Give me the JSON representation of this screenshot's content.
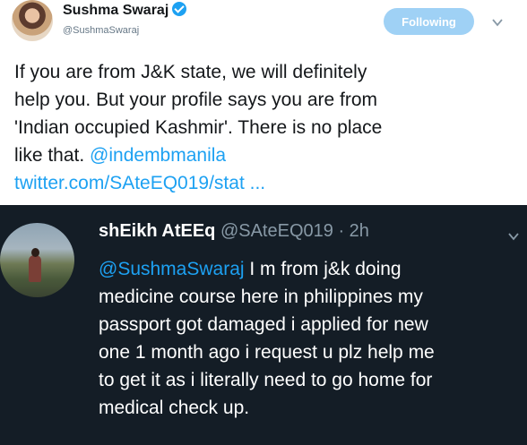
{
  "tweet": {
    "author": {
      "name": "Sushma Swaraj",
      "handle": "@SushmaSwaraj",
      "verified": true
    },
    "follow_button_label": "Following",
    "text_lines": [
      "If you are from J&K state, we will definitely",
      "help you. But your profile says you are from",
      "'Indian occupied Kashmir'. There is no place"
    ],
    "text_line4_plain": "like that. ",
    "mention": "@indembmanila",
    "link_text": "twitter.com/SAteEQ019/stat ..."
  },
  "reply": {
    "author": {
      "name": "shEikh AtEEq",
      "handle": "@SAteEQ019",
      "separator": " · ",
      "time": "2h"
    },
    "mention": "@SushmaSwaraj",
    "text_line1_rest": " I m from j&k doing",
    "text_lines": [
      "medicine course here in philippines  my",
      "passport got damaged i applied for new",
      "one 1 month ago i request u plz help me",
      "to get it as i literally need to go home for",
      "medical check up."
    ]
  },
  "colors": {
    "link": "#1da1f2",
    "dark_background": "#141d26",
    "follow_button": "#9fd1f5",
    "verified_badge": "#1da1f2"
  },
  "icons": {
    "verified": "verified-badge-icon",
    "menu": "chevron-down-icon"
  }
}
